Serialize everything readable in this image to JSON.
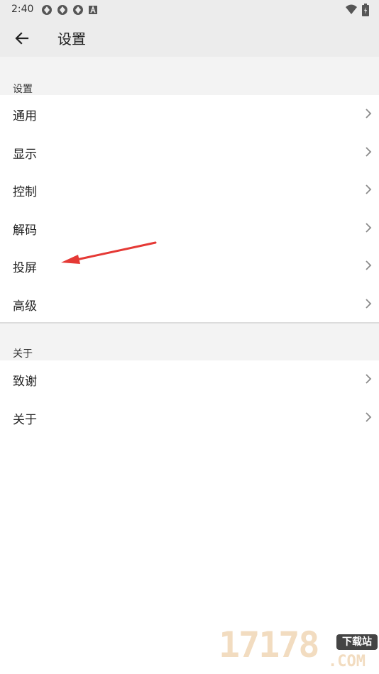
{
  "status_bar": {
    "time": "2:40",
    "left_icons": [
      "shield-icon",
      "shield-icon",
      "shield-icon",
      "a-box-icon"
    ],
    "right_icons": [
      "wifi-icon",
      "battery-icon"
    ]
  },
  "app_bar": {
    "back_icon": "arrow-left-icon",
    "title": "设置"
  },
  "sections": [
    {
      "header": "设置",
      "items": [
        {
          "label": "通用"
        },
        {
          "label": "显示"
        },
        {
          "label": "控制"
        },
        {
          "label": "解码"
        },
        {
          "label": "投屏"
        },
        {
          "label": "高级"
        }
      ]
    },
    {
      "header": "关于",
      "items": [
        {
          "label": "致谢"
        },
        {
          "label": "关于"
        }
      ]
    }
  ],
  "annotation": {
    "icon": "red-arrow-icon",
    "color": "#e53935"
  },
  "watermark": {
    "digits": "17178",
    "badge": "下载站",
    "suffix": ".COM"
  },
  "colors": {
    "bar_bg": "#ececec",
    "band_bg": "#f3f3f3",
    "text": "#222222",
    "chevron": "#8a8a8a"
  }
}
